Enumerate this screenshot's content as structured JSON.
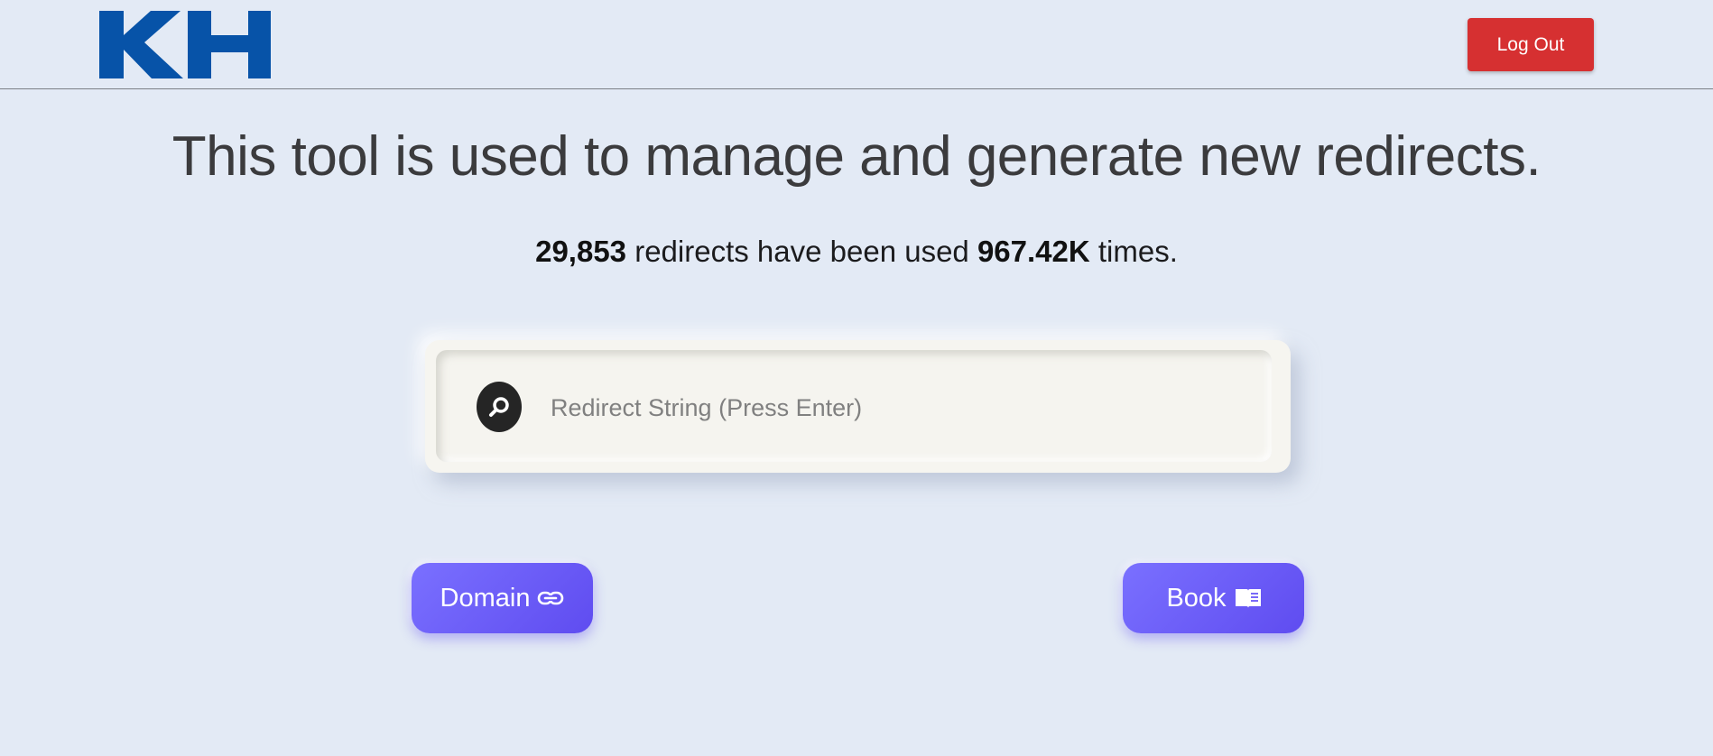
{
  "header": {
    "logo_text": "KH",
    "logout_label": "Log Out"
  },
  "main": {
    "title": "This tool is used to manage and generate new redirects.",
    "stats": {
      "redirect_count": "29,853",
      "text_middle": " redirects have been used ",
      "usage_count": "967.42K",
      "text_end": " times."
    },
    "search": {
      "placeholder": "Redirect String (Press Enter)",
      "value": "",
      "icon": "search-icon"
    },
    "buttons": {
      "domain_label": "Domain",
      "domain_icon": "link-icon",
      "book_label": "Book",
      "book_icon": "book-open-icon"
    }
  },
  "colors": {
    "background": "#e3eaf5",
    "logo_blue": "#0753a8",
    "logout_red": "#d63031",
    "accent_purple": "#6a5cff"
  }
}
